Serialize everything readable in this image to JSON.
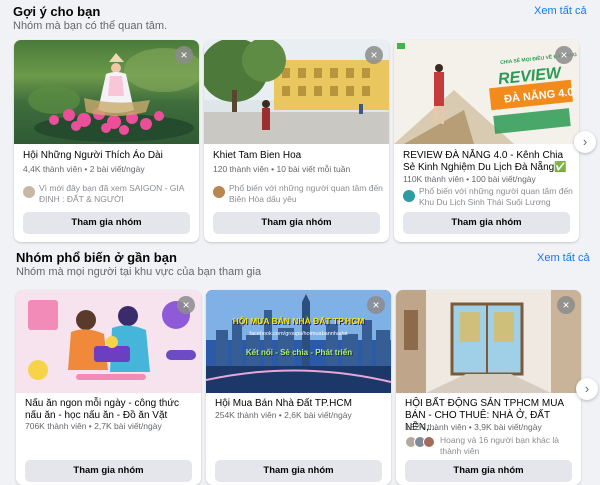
{
  "suggested": {
    "title": "Gợi ý cho bạn",
    "subtitle": "Nhóm mà bạn có thể quan tâm.",
    "see_all": "Xem tất cả",
    "cards": [
      {
        "name": "Hội Những Người Thích Áo Dài",
        "stats": "4,4K thành viên • 2 bài viết/ngày",
        "note": "Vì mới đây bạn đã xem SAIGON - GIA ĐỊNH : ĐẤT & NGƯỜI",
        "join": "Tham gia nhóm"
      },
      {
        "name": "Khiet Tam Bien Hoa",
        "stats": "120 thành viên • 10 bài viết mỗi tuần",
        "note": "Phổ biến với những người quan tâm đến Biên Hòa dấu yêu",
        "join": "Tham gia nhóm"
      },
      {
        "name": "REVIEW ĐÀ NẴNG 4.0 - Kênh Chia Sẻ Kinh Nghiệm Du Lịch Đà Nẵng✅",
        "stats": "110K thành viên • 100 bài viết/ngày",
        "note": "Phổ biến với những người quan tâm đến Khu Du Lịch Sinh Thái Suối Lương",
        "join": "Tham gia nhóm",
        "img_text_1": "REVIEW",
        "img_text_2": "ĐÀ NẴNG 4.0",
        "img_text_top": "CHIA SẺ MỌI ĐIỀU VỀ ĐÀ NẴNG"
      }
    ]
  },
  "popular": {
    "title": "Nhóm phổ biến ở gần bạn",
    "subtitle": "Nhóm mà mọi người tại khu vực của bạn tham gia",
    "see_all": "Xem tất cả",
    "cards": [
      {
        "name": "Nấu ăn ngon mỗi ngày - công thức nấu ăn - học nấu ăn - Đồ ăn Vặt",
        "stats": "706K thành viên • 2,7K bài viết/ngày",
        "join": "Tham gia nhóm"
      },
      {
        "name": "Hội Mua Bán Nhà Đất TP.HCM",
        "stats": "254K thành viên • 2,6K bài viết/ngày",
        "join": "Tham gia nhóm",
        "img_title": "HỘI MUA BÁN NHÀ ĐẤT TP.HCM",
        "img_url": "facebook.com/groups/hoimuabannhadat",
        "img_slogan": "Kết nối - Sẻ chia - Phát triển"
      },
      {
        "name": "HỘI BẤT ĐỘNG SẢN TPHCM MUA BÁN - CHO THUÊ: NHÀ Ở, ĐẤT NỀN,...",
        "stats": "132K thành viên • 3,9K bài viết/ngày",
        "note": "Hoang và 16 người bạn khác là thành viên",
        "join": "Tham gia nhóm"
      }
    ]
  },
  "icons": {
    "close": "×",
    "next": "›"
  }
}
